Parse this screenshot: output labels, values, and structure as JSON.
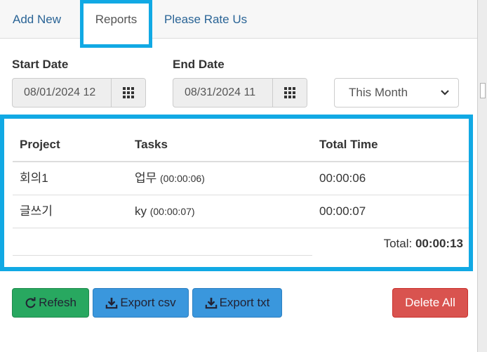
{
  "tabs": [
    {
      "label": "Add New"
    },
    {
      "label": "Reports"
    },
    {
      "label": "Please Rate Us"
    }
  ],
  "filters": {
    "start_label": "Start Date",
    "start_value": "08/01/2024 12",
    "end_label": "End Date",
    "end_value": "08/31/2024 11",
    "range_selected": "This Month"
  },
  "table": {
    "headers": [
      "Project",
      "Tasks",
      "Total Time"
    ],
    "rows": [
      {
        "project": "회의1",
        "task": "업무",
        "task_time": "(00:00:06)",
        "total": "00:00:06"
      },
      {
        "project": "글쓰기",
        "task": "ky",
        "task_time": "(00:00:07)",
        "total": "00:00:07"
      }
    ],
    "total_label": "Total:",
    "total_value": "00:00:13"
  },
  "buttons": {
    "refresh": "Refesh",
    "export_csv": "Export csv",
    "export_txt": "Export txt",
    "delete_all": "Delete All"
  },
  "icons": {
    "calendar": "grid-icon",
    "refresh": "refresh-icon",
    "download": "download-icon",
    "dropdown": "chevron-down-icon"
  },
  "colors": {
    "highlight": "#11a9e4",
    "link": "#2a6496",
    "success": "#28a860",
    "primary": "#3a97dd",
    "danger": "#d9534f"
  }
}
